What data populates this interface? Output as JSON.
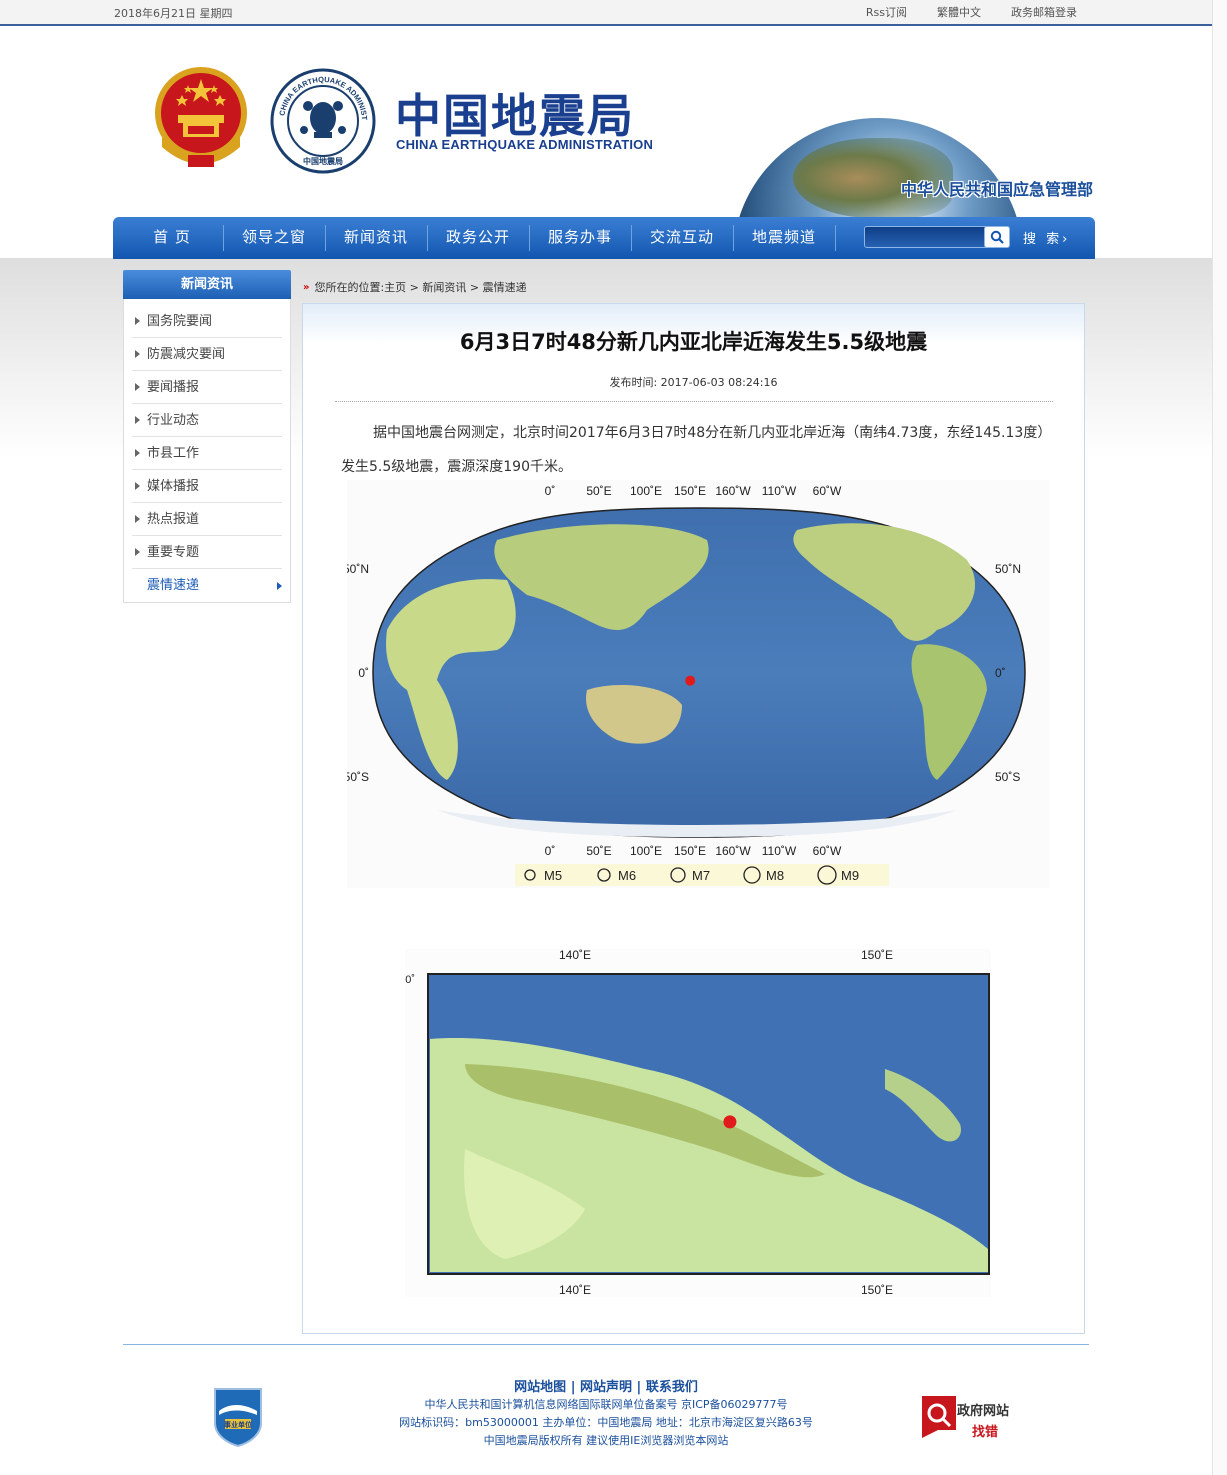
{
  "topbar": {
    "date": "2018年6月21日  星期四",
    "links": [
      "Rss订阅",
      "繁體中文",
      "政务邮箱登录"
    ]
  },
  "header": {
    "brand_cn": "中国地震局",
    "brand_en": "CHINA EARTHQUAKE ADMINISTRATION",
    "seal_top_text": "CHINA EARTHQUAKE ADMINISTRATION",
    "seal_bottom_text": "中国地震局",
    "ministry": "中华人民共和国应急管理部"
  },
  "nav": {
    "items": [
      "首 页",
      "领导之窗",
      "新闻资讯",
      "政务公开",
      "服务办事",
      "交流互动",
      "地震频道"
    ],
    "search_label": "搜 索",
    "search_arrow": "›"
  },
  "sidebar": {
    "title": "新闻资讯",
    "items": [
      "国务院要闻",
      "防震减灾要闻",
      "要闻播报",
      "行业动态",
      "市县工作",
      "媒体播报",
      "热点报道",
      "重要专题",
      "震情速递"
    ],
    "active_index": 8
  },
  "breadcrumb": {
    "marker": "»",
    "text": "您所在的位置:主页 > 新闻资讯 > 震情速递"
  },
  "article": {
    "title": "6月3日7时48分新几内亚北岸近海发生5.5级地震",
    "meta": "发布时间: 2017-06-03 08:24:16",
    "body": "据中国地震台网测定，北京时间2017年6月3日7时48分在新几内亚北岸近海（南纬4.73度，东经145.13度）发生5.5级地震，震源深度190千米。"
  },
  "map1": {
    "top_lon": [
      "0˚",
      "50˚E",
      "100˚E",
      "150˚E",
      "160˚W",
      "110˚W",
      "60˚W"
    ],
    "bottom_lon": [
      "0˚",
      "50˚E",
      "100˚E",
      "150˚E",
      "160˚W",
      "110˚W",
      "60˚W"
    ],
    "lat_left": [
      "50˚N",
      "0˚",
      "50˚S"
    ],
    "lat_right": [
      "50˚N",
      "0˚",
      "50˚S"
    ],
    "magnitudes": [
      "M5",
      "M6",
      "M7",
      "M8",
      "M9"
    ],
    "epicenter": {
      "lat": -4.73,
      "lon": 145.13
    }
  },
  "map2": {
    "top_lon": [
      "140˚E",
      "150˚E"
    ],
    "bottom_lon": [
      "140˚E",
      "150˚E"
    ],
    "lat_label": "0˚",
    "epicenter": {
      "lat": -4.73,
      "lon": 145.13
    }
  },
  "footer": {
    "links": [
      "网站地图",
      "网站声明",
      "联系我们"
    ],
    "separator": "|",
    "line1": "中华人民共和国计算机信息网络国际联网单位备案号  京ICP备06029777号",
    "line2": "网站标识码：bm53000001  主办单位：中国地震局  地址：北京市海淀区复兴路63号",
    "line3": "中国地震局版权所有  建议使用IE浏览器浏览本网站",
    "badge_left": "事业单位",
    "badge_right_top": "政府网站",
    "badge_right_bottom": "找错"
  },
  "colors": {
    "nav_blue": "#1356b0",
    "brand_blue": "#1a3f8f",
    "epicenter_red": "#e11b1b"
  }
}
